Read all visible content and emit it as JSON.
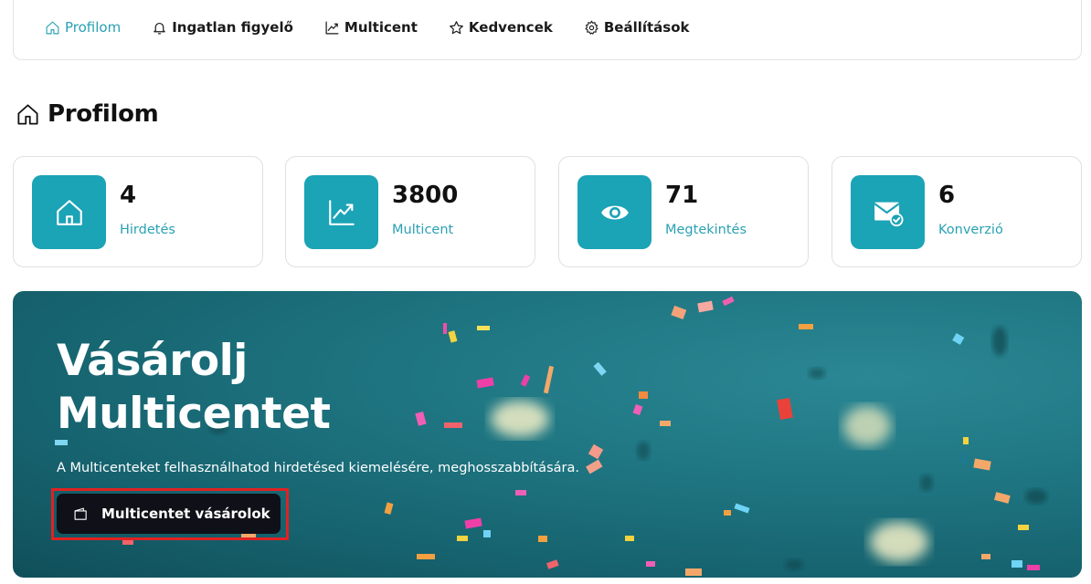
{
  "nav": {
    "items": [
      {
        "label": "Profilom",
        "icon": "home-icon",
        "active": true
      },
      {
        "label": "Ingatlan figyelő",
        "icon": "bell-icon",
        "active": false
      },
      {
        "label": "Multicent",
        "icon": "chart-line-icon",
        "active": false
      },
      {
        "label": "Kedvencek",
        "icon": "star-icon",
        "active": false
      },
      {
        "label": "Beállítások",
        "icon": "gear-icon",
        "active": false
      }
    ]
  },
  "page": {
    "title": "Profilom",
    "title_icon": "home-icon"
  },
  "stats": [
    {
      "value": "4",
      "label": "Hirdetés",
      "icon": "home-icon"
    },
    {
      "value": "3800",
      "label": "Multicent",
      "icon": "chart-line-icon"
    },
    {
      "value": "71",
      "label": "Megtekintés",
      "icon": "eye-icon"
    },
    {
      "value": "6",
      "label": "Konverzió",
      "icon": "mail-check-icon"
    }
  ],
  "banner": {
    "title": "Vásárolj Multicentet",
    "subtitle": "A Multicenteket felhasználhatod hirdetésed kiemelésére, meghosszabbítására.",
    "button_label": "Multicentet vásárolok",
    "button_icon": "wallet-icon"
  },
  "colors": {
    "accent": "#2aa1b3",
    "icon_bg": "#1ba3b6",
    "button_bg": "#101018",
    "highlight": "#e02222"
  }
}
